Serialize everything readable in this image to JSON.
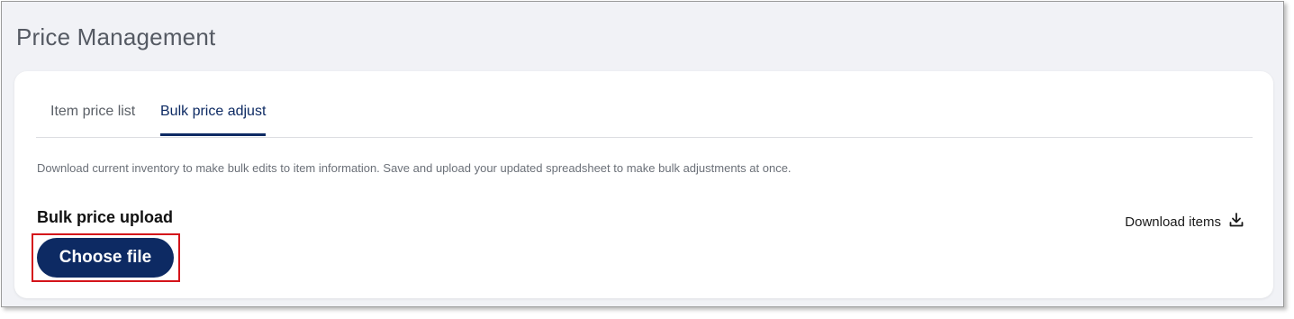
{
  "page": {
    "title": "Price Management"
  },
  "tabs": [
    {
      "label": "Item price list",
      "active": false
    },
    {
      "label": "Bulk price adjust",
      "active": true
    }
  ],
  "bulk": {
    "description": "Download current inventory to make bulk edits to item information. Save and upload your updated spreadsheet to make bulk adjustments at once.",
    "section_title": "Bulk price upload",
    "choose_file_label": "Choose file",
    "download_label": "Download items",
    "download_icon": "download-icon"
  },
  "colors": {
    "brand": "#0d2a63",
    "highlight": "#d4141b",
    "background": "#f1f2f6"
  }
}
